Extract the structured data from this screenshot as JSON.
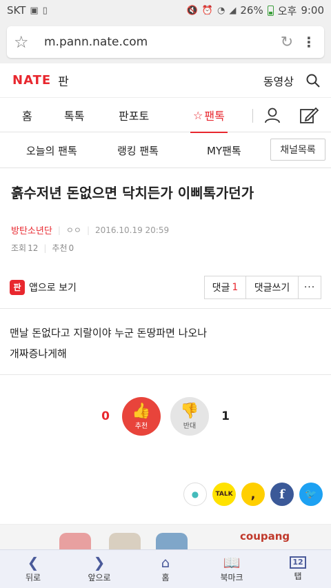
{
  "statusbar": {
    "carrier": "SKT",
    "battery": "26%",
    "ampm": "오후",
    "time": "9:00"
  },
  "browser": {
    "url": "m.pann.nate.com"
  },
  "header": {
    "logo": "NATE",
    "section": "판",
    "video_link": "동영상"
  },
  "tabs": [
    {
      "label": "홈"
    },
    {
      "label": "톡톡"
    },
    {
      "label": "판포토"
    },
    {
      "label": "팬톡"
    }
  ],
  "subtabs": [
    {
      "label": "오늘의 팬톡"
    },
    {
      "label": "랭킹 팬톡"
    },
    {
      "label": "MY팬톡"
    }
  ],
  "channel_button": "채널목록",
  "post": {
    "title": "흙수저년 돈없으면 닥치든가 이삐톡가던가",
    "author": "방탄소년단",
    "writer_mask": "ㅇㅇ",
    "datetime": "2016.10.19 20:59",
    "views_label": "조회",
    "views": "12",
    "recommend_label": "추천",
    "recommend": "0",
    "body_line1": "맨날 돈없다고 지랄이야 누군 돈땅파면 나오나",
    "body_line2": "개짜증나게해"
  },
  "actions": {
    "app_badge": "판",
    "app_view": "앱으로 보기",
    "comment_label": "댓글",
    "comment_count": "1",
    "write_comment": "댓글쓰기",
    "more": "···"
  },
  "votes": {
    "up_count": "0",
    "up_label": "추천",
    "down_label": "반대",
    "down_count": "1"
  },
  "share": {
    "talk": "TALK",
    "story": ",",
    "facebook": "f"
  },
  "ad": {
    "brand": "coupang"
  },
  "bottombar": [
    {
      "label": "뒤로",
      "icon": "chevron-left-icon"
    },
    {
      "label": "앞으로",
      "icon": "chevron-right-icon"
    },
    {
      "label": "홈",
      "icon": "home-icon"
    },
    {
      "label": "북마크",
      "icon": "bookmark-icon"
    },
    {
      "label": "탭",
      "icon": "tabs-icon",
      "count": "12"
    }
  ]
}
